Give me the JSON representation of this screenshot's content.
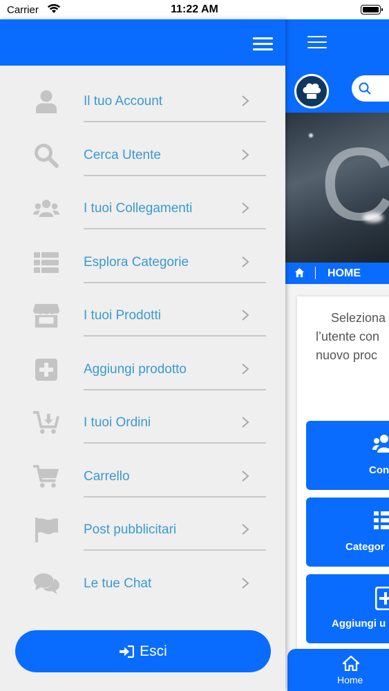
{
  "status_bar": {
    "carrier": "Carrier",
    "time": "11:22 AM"
  },
  "colors": {
    "primary": "#0a6cff",
    "menu_text": "#3a9ad0",
    "icon_gray": "#c4c4c4",
    "drawer_bg": "#efefef"
  },
  "drawer": {
    "menu_icon": "hamburger-icon",
    "items": [
      {
        "label": "Il tuo Account",
        "icon": "user-icon"
      },
      {
        "label": "Cerca Utente",
        "icon": "search-icon"
      },
      {
        "label": "I tuoi Collegamenti",
        "icon": "users-icon"
      },
      {
        "label": "Esplora Categorie",
        "icon": "list-icon"
      },
      {
        "label": "I tuoi Prodotti",
        "icon": "store-icon"
      },
      {
        "label": "Aggiungi prodotto",
        "icon": "plus-square-icon"
      },
      {
        "label": "I tuoi Ordini",
        "icon": "cart-download-icon"
      },
      {
        "label": "Carrello",
        "icon": "cart-icon"
      },
      {
        "label": "Post pubblicitari",
        "icon": "flag-icon"
      },
      {
        "label": "Le tue Chat",
        "icon": "comments-icon"
      }
    ],
    "logout_label": "Esci"
  },
  "app": {
    "breadcrumb_label": "HOME",
    "intro_lines": [
      "Seleziona",
      "l’utente con",
      "nuovo proc"
    ],
    "tiles": [
      {
        "label": "Con",
        "icon": "users-icon"
      },
      {
        "label": "Categor",
        "icon": "list-icon"
      },
      {
        "label": "Aggiungi u",
        "icon": "plus-square-icon"
      }
    ],
    "bottom_tab_label": "Home"
  }
}
